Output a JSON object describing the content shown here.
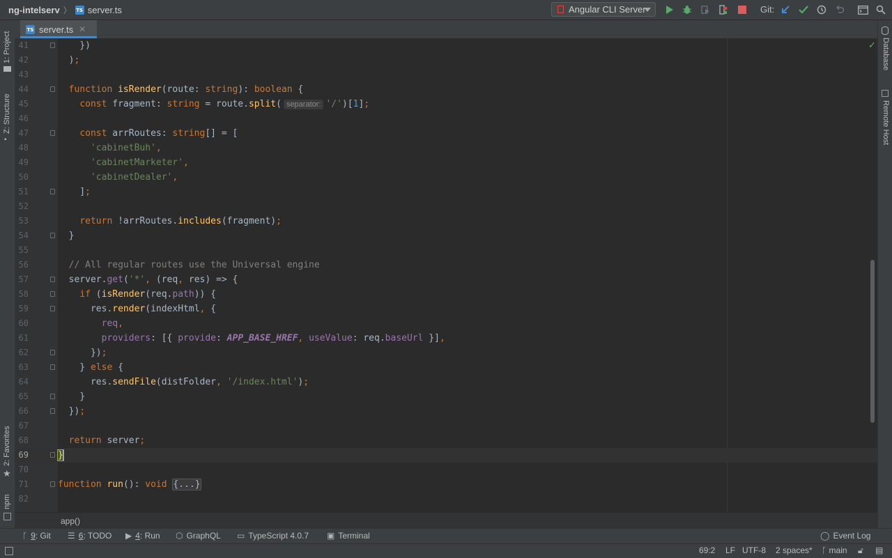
{
  "breadcrumb": {
    "project": "ng-intelserv",
    "file": "server.ts"
  },
  "toolbar": {
    "run_config": "Angular CLI Server",
    "git_label": "Git:",
    "icons": [
      "run-icon",
      "debug-icon",
      "coverage-icon",
      "profile-icon",
      "stop-icon",
      "git-update-icon",
      "git-commit-icon",
      "history-icon",
      "rollback-icon",
      "terminal-window-icon",
      "search-icon"
    ]
  },
  "tabs": [
    {
      "label": "server.ts",
      "active": true
    }
  ],
  "left_panels": {
    "project": "1: Project",
    "structure": "Z: Structure",
    "favorites": "2: Favorites",
    "npm": "npm"
  },
  "right_panels": {
    "database": "Database",
    "remote_host": "Remote Host"
  },
  "editor": {
    "lines": [
      {
        "n": "41",
        "t": "    })"
      },
      {
        "n": "42",
        "t": "  );"
      },
      {
        "n": "43",
        "t": ""
      },
      {
        "n": "44",
        "t": "  function isRender(route: string): boolean {"
      },
      {
        "n": "45",
        "t": "    const fragment: string = route.split( separator: '/')[1];"
      },
      {
        "n": "46",
        "t": ""
      },
      {
        "n": "47",
        "t": "    const arrRoutes: string[] = ["
      },
      {
        "n": "48",
        "t": "      'cabinetBuh',"
      },
      {
        "n": "49",
        "t": "      'cabinetMarketer',"
      },
      {
        "n": "50",
        "t": "      'cabinetDealer',"
      },
      {
        "n": "51",
        "t": "    ];"
      },
      {
        "n": "52",
        "t": ""
      },
      {
        "n": "53",
        "t": "    return !arrRoutes.includes(fragment);"
      },
      {
        "n": "54",
        "t": "  }"
      },
      {
        "n": "55",
        "t": ""
      },
      {
        "n": "56",
        "t": "  // All regular routes use the Universal engine"
      },
      {
        "n": "57",
        "t": "  server.get('*', (req, res) => {"
      },
      {
        "n": "58",
        "t": "    if (isRender(req.path)) {"
      },
      {
        "n": "59",
        "t": "      res.render(indexHtml, {"
      },
      {
        "n": "60",
        "t": "        req,"
      },
      {
        "n": "61",
        "t": "        providers: [{ provide: APP_BASE_HREF, useValue: req.baseUrl }],"
      },
      {
        "n": "62",
        "t": "      });"
      },
      {
        "n": "63",
        "t": "    } else {"
      },
      {
        "n": "64",
        "t": "      res.sendFile(distFolder, '/index.html');"
      },
      {
        "n": "65",
        "t": "    }"
      },
      {
        "n": "66",
        "t": "  });"
      },
      {
        "n": "67",
        "t": ""
      },
      {
        "n": "68",
        "t": "  return server;"
      },
      {
        "n": "69",
        "t": "}"
      },
      {
        "n": "70",
        "t": ""
      },
      {
        "n": "71",
        "t": "function run(): void {...}"
      },
      {
        "n": "82",
        "t": ""
      }
    ],
    "current_line": "69",
    "param_hint": "separator:"
  },
  "crumb_path": "app()",
  "tool_windows": [
    {
      "key": "9",
      "label": ": Git",
      "icon": "git-branch-icon"
    },
    {
      "key": "6",
      "label": ": TODO",
      "icon": "todo-list-icon"
    },
    {
      "key": "4",
      "label": ": Run",
      "icon": "run-icon"
    },
    {
      "key": "",
      "label": "GraphQL",
      "icon": "graphql-icon"
    },
    {
      "key": "",
      "label": "TypeScript 4.0.7",
      "icon": "typescript-icon"
    },
    {
      "key": "",
      "label": "Terminal",
      "icon": "terminal-icon"
    }
  ],
  "event_log": "Event Log",
  "status": {
    "position": "69:2",
    "line_separator": "LF",
    "encoding": "UTF-8",
    "indent": "2 spaces*",
    "branch": "main"
  }
}
